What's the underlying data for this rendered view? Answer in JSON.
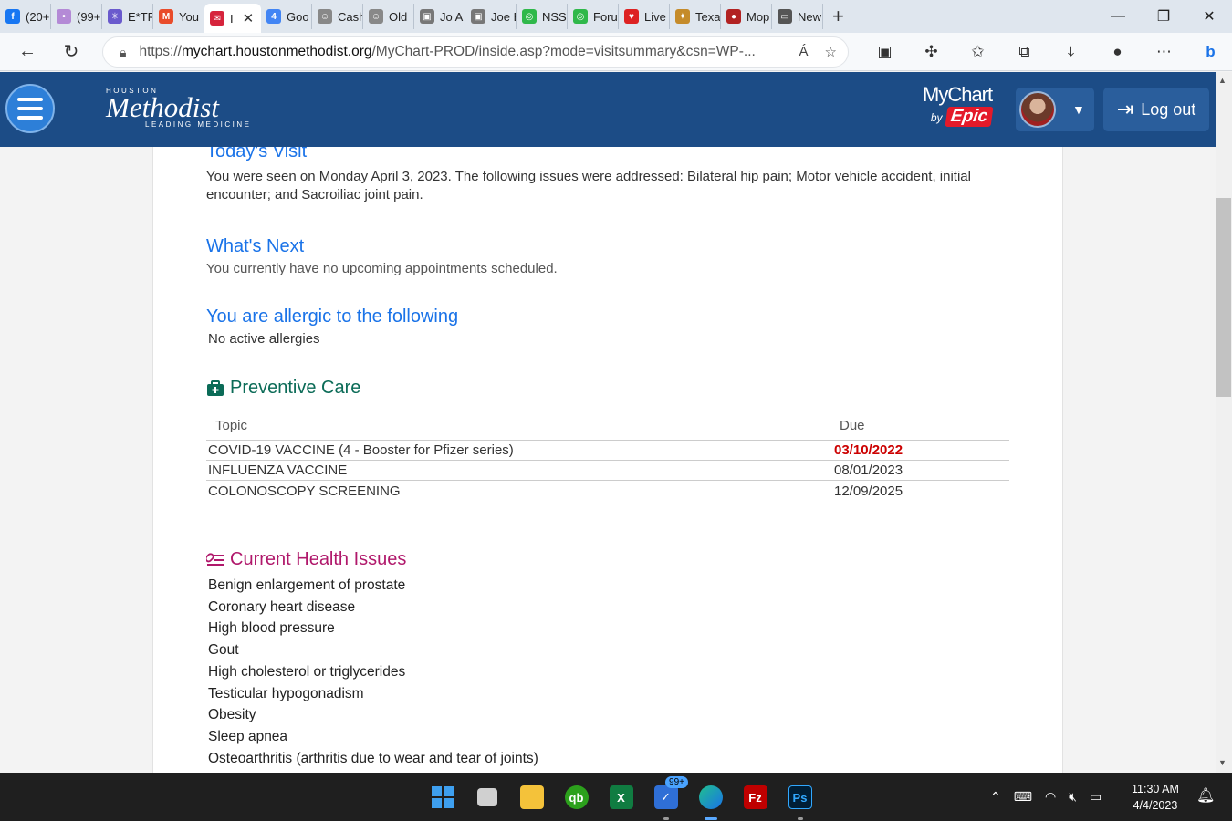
{
  "browser": {
    "tabs": [
      {
        "title": "(20+",
        "color": "#1877f2",
        "glyph": "f"
      },
      {
        "title": "(99+",
        "color": "#b48ad6",
        "glyph": "•"
      },
      {
        "title": "E*TR",
        "color": "#6a5acd",
        "glyph": "✳"
      },
      {
        "title": "You",
        "color": "#e94c2b",
        "glyph": "M"
      },
      {
        "title": "I",
        "color": "#d6243c",
        "glyph": "✉",
        "active": true
      },
      {
        "title": "Goo",
        "color": "#4285f4",
        "glyph": "4"
      },
      {
        "title": "Cash",
        "color": "#888888",
        "glyph": "☺"
      },
      {
        "title": "Old",
        "color": "#888888",
        "glyph": "☺"
      },
      {
        "title": "Jo A",
        "color": "#777777",
        "glyph": "▣"
      },
      {
        "title": "Joe E",
        "color": "#777777",
        "glyph": "▣"
      },
      {
        "title": "NSS",
        "color": "#2fb84a",
        "glyph": "◎"
      },
      {
        "title": "Foru",
        "color": "#2fb84a",
        "glyph": "◎"
      },
      {
        "title": "Live",
        "color": "#d22",
        "glyph": "♥"
      },
      {
        "title": "Texa",
        "color": "#c58b2a",
        "glyph": "✦"
      },
      {
        "title": "Mop",
        "color": "#b22222",
        "glyph": "●"
      },
      {
        "title": "New",
        "color": "#555555",
        "glyph": "▭"
      }
    ],
    "url_prefix": "https://",
    "url_host": "mychart.houstonmethodist.org",
    "url_path": "/MyChart-PROD/inside.asp?mode=visitsummary&csn=WP-...",
    "read_aloud": "Á",
    "window_controls": [
      "—",
      "❐",
      "✕"
    ]
  },
  "header": {
    "logo_top": "HOUSTON",
    "logo_main": "Methodist",
    "logo_bottom": "LEADING MEDICINE",
    "mychart": "MyChart",
    "by": "by",
    "epic": "Epic",
    "logout": "Log out"
  },
  "visit": {
    "title": "Today's Visit",
    "text": "You were seen on Monday April 3, 2023. The following issues were addressed: Bilateral hip pain; Motor vehicle accident, initial encounter; and Sacroiliac joint pain."
  },
  "next": {
    "title": "What's Next",
    "text": "You currently have no upcoming appointments scheduled."
  },
  "allergies": {
    "title": "You are allergic to the following",
    "text": "No active allergies"
  },
  "preventive": {
    "title": "Preventive Care",
    "col_topic": "Topic",
    "col_due": "Due",
    "rows": [
      {
        "topic": "COVID-19 VACCINE (4 - Booster for Pfizer series)",
        "due": "03/10/2022",
        "overdue": true
      },
      {
        "topic": "INFLUENZA VACCINE",
        "due": "08/01/2023",
        "overdue": false
      },
      {
        "topic": "COLONOSCOPY SCREENING",
        "due": "12/09/2025",
        "overdue": false
      }
    ]
  },
  "health_issues": {
    "title": "Current Health Issues",
    "items": [
      "Benign enlargement of prostate",
      "Coronary heart disease",
      "High blood pressure",
      "Gout",
      "High cholesterol or triglycerides",
      "Testicular hypogonadism",
      "Obesity",
      "Sleep apnea",
      "Osteoarthritis (arthritis due to wear and tear of joints)"
    ]
  },
  "taskbar": {
    "mail_badge": "99+",
    "time": "11:30 AM",
    "date": "4/4/2023"
  },
  "colors": {
    "header_bg": "#1c4c86",
    "link_blue": "#1a73e8",
    "preventive_green": "#0b6b57",
    "health_magenta": "#b0186b",
    "overdue_red": "#cc0000"
  }
}
